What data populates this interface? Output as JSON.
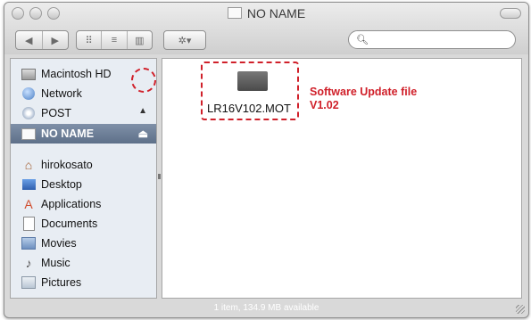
{
  "window": {
    "title": "NO NAME"
  },
  "toolbar": {
    "back_icon": "back-arrow-icon",
    "forward_icon": "forward-arrow-icon",
    "view_icons": [
      "icon-view-icon",
      "list-view-icon",
      "column-view-icon"
    ],
    "action_icon": "gear-icon",
    "search": {
      "value": "",
      "placeholder": ""
    }
  },
  "sidebar": {
    "items": [
      {
        "label": "Macintosh HD",
        "icon": "hard-disk-icon"
      },
      {
        "label": "Network",
        "icon": "globe-icon"
      },
      {
        "label": "POST",
        "icon": "disk-icon",
        "eject": true
      },
      {
        "label": "NO NAME",
        "icon": "drive-icon",
        "eject": true,
        "selected": true
      },
      {
        "label": "hirokosato",
        "icon": "home-icon"
      },
      {
        "label": "Desktop",
        "icon": "desktop-icon"
      },
      {
        "label": "Applications",
        "icon": "applications-icon"
      },
      {
        "label": "Documents",
        "icon": "documents-icon"
      },
      {
        "label": "Movies",
        "icon": "movies-icon"
      },
      {
        "label": "Music",
        "icon": "music-icon"
      },
      {
        "label": "Pictures",
        "icon": "pictures-icon"
      }
    ]
  },
  "content": {
    "files": [
      {
        "name": "LR16V102.MOT",
        "icon": "file-icon"
      }
    ],
    "annotation": {
      "line1": "Software Update file",
      "line2": "V1.02",
      "color": "#d0202a"
    }
  },
  "status_bar": {
    "text": "1 item, 134.9 MB available"
  }
}
